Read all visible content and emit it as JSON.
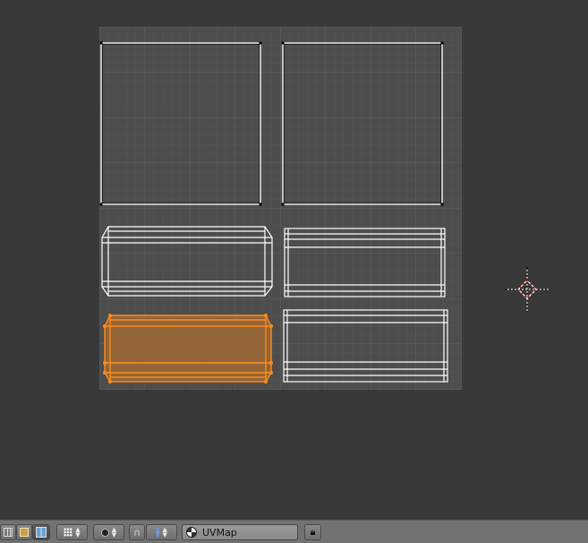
{
  "viewport": {
    "cursor_icon": "2d-cursor-icon"
  },
  "header": {
    "view_buttons": [
      "grid-view-icon",
      "image-view-icon",
      "split-view-icon"
    ],
    "pivot_icon": "pivot-point-icon",
    "proportional_icon": "proportional-edit-icon",
    "snap_icon": "snap-magnet-icon",
    "mirror_icon": "uv-mirror-icon",
    "uv_map": {
      "label": "UVMap",
      "icon": "uv-map-icon"
    },
    "lock_icon": "lock-icon"
  },
  "colors": {
    "background": "#393939",
    "uv_space": "#4d4d4d",
    "grid": "#555555",
    "edge": "#ffffff",
    "selection": "#ff8c1a",
    "selected_face_fill": "#a06a35"
  }
}
